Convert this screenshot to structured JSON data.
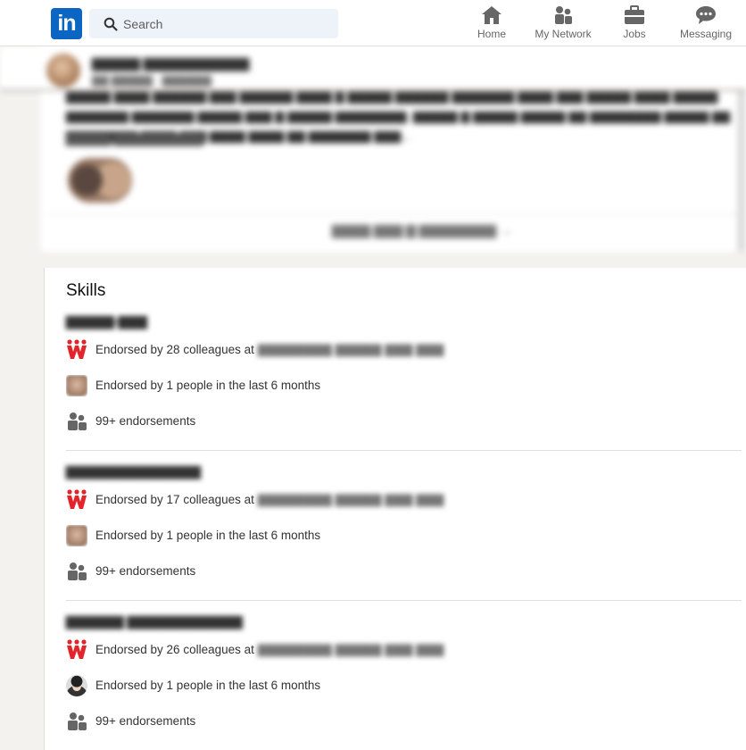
{
  "nav": {
    "logo": "in",
    "search_placeholder": "Search",
    "items": [
      {
        "label": "Home",
        "icon": "home-icon"
      },
      {
        "label": "My Network",
        "icon": "people-icon"
      },
      {
        "label": "Jobs",
        "icon": "briefcase-icon"
      },
      {
        "label": "Messaging",
        "icon": "chat-icon"
      }
    ]
  },
  "colors": {
    "brand": "#0a66c2",
    "company_logo_red": "#e3242b",
    "page_bg": "#f3f2ef"
  },
  "skills": {
    "title": "Skills",
    "items": [
      {
        "rows": [
          {
            "text": "Endorsed by 28 colleagues at",
            "icon": "company-logo-icon"
          },
          {
            "text": "Endorsed by 1 people in the last 6 months",
            "icon": "avatar-icon"
          },
          {
            "text": "99+ endorsements",
            "icon": "people-icon"
          }
        ]
      },
      {
        "rows": [
          {
            "text": "Endorsed by 17 colleagues at",
            "icon": "company-logo-icon"
          },
          {
            "text": "Endorsed by 1 people in the last 6 months",
            "icon": "avatar-icon"
          },
          {
            "text": "99+ endorsements",
            "icon": "people-icon"
          }
        ]
      },
      {
        "rows": [
          {
            "text": "Endorsed by 26 colleagues at",
            "icon": "company-logo-icon"
          },
          {
            "text": "Endorsed by 1 people in the last 6 months",
            "icon": "avatar-icon"
          },
          {
            "text": "99+ endorsements",
            "icon": "people-icon"
          }
        ]
      }
    ]
  }
}
